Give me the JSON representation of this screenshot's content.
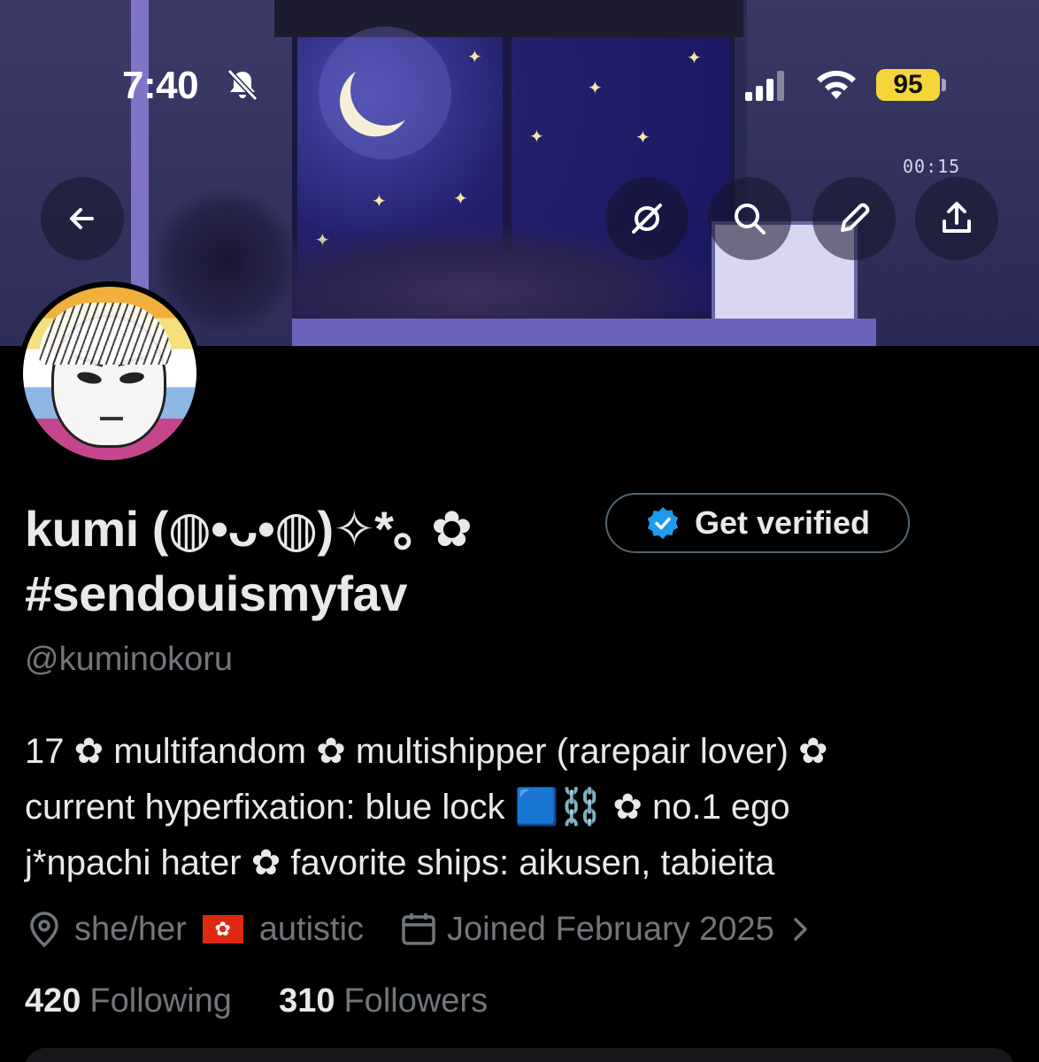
{
  "status_bar": {
    "time": "7:40",
    "battery": "95",
    "bell_icon": "bell-slash-icon",
    "signal_icon": "cellular-signal-icon",
    "wifi_icon": "wifi-icon"
  },
  "banner": {
    "clock": "00:15"
  },
  "header_actions": {
    "back": "arrow-left-icon",
    "grok": "grok-icon",
    "search": "search-icon",
    "edit": "pencil-icon",
    "share": "share-icon"
  },
  "profile": {
    "display_name_line1": "kumi (◍•ᴗ•◍)✧*｡ ✿",
    "display_name_line2": "#sendouismyfav",
    "handle": "@kuminokoru",
    "verify_button_label": "Get verified",
    "bio_lines": [
      "17 ✿ multifandom ✿ multishipper (rarepair lover) ✿",
      "current hyperfixation: blue lock 🟦⛓️ ✿ no.1 ego",
      "j*npachi hater ✿ favorite ships: aikusen, tabieita"
    ],
    "location": "she/her",
    "flag": "🇭🇰",
    "location_extra": "autistic",
    "joined": "Joined February 2025",
    "following_count": "420",
    "following_label": "Following",
    "followers_count": "310",
    "followers_label": "Followers"
  },
  "colors": {
    "background": "#000000",
    "text_primary": "#e7e9ea",
    "text_secondary": "#71767b",
    "verified_blue": "#1d9bf0",
    "battery_yellow": "#f4d63a"
  }
}
